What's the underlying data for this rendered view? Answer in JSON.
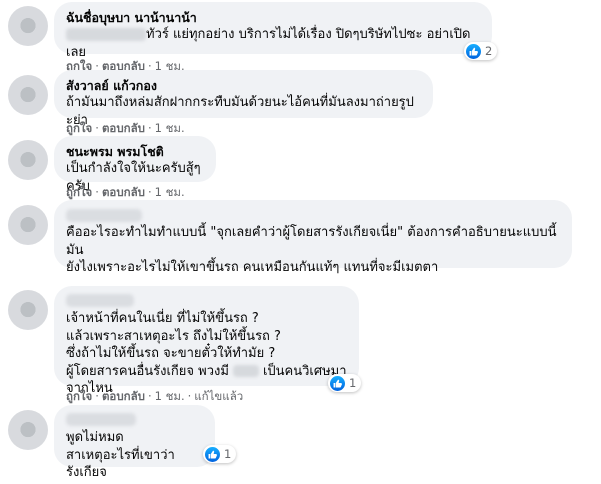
{
  "actions": {
    "like": "ถูกใจ",
    "reply": "ตอบกลับ",
    "time_1h": "1 ชม.",
    "edited": "แก้ไขแล้ว"
  },
  "comments": [
    {
      "author": "ฉันชื่อบุษบา นาน้านาน้า",
      "text": "ทัวร์ แย่ทุกอย่าง บริการไม่ได้เรื่อง ปิดๆบริษัทไปซะ อย่าเปิดเลย",
      "reaction_count": "2"
    },
    {
      "author": "สังวาลย์ แก้วกอง",
      "text": "ถ้ามันมาถึงหล่มสักฝากกระทืบมันด้วยนะไอ้คนที่มันลงมาถ่ายรูป ะย่า"
    },
    {
      "author": "ชนะพรม พรมโชติ",
      "text": "เป็นกำลังใจให้นะครับสู้ๆครับ"
    },
    {
      "author": "",
      "text_lines": [
        "คืออะไรอะทำไมทำแบบนี้ \"จุกเลยคำว่าผู้โดยสารรังเกียจเนี่ย\" ต้องการคำอธิบายนะแบบนี้ มัน",
        "ยังไงเพราะอะไรไม่ให้เขาขึ้นรถ คนเหมือนกันแท้ๆ แทนที่จะมีเมตตา"
      ]
    },
    {
      "author": "",
      "text_lines": [
        "เจ้าหน้าที่คนในเนี่ย ที่ไม่ให้ขึ้นรถ ?",
        "แล้วเพราะสาเหตุอะไร ถึงไม่ให้ขึ้นรถ ?",
        "ซึ่งถ้าไม่ให้ขึ้นรถ จะขายตั๋วให้ทำมัย ?",
        "ผู้โดยสารคนอื่นรังเกียจ พวงมี",
        "เป็นคนวิเศษมาจากไหน"
      ],
      "reaction_count": "1"
    },
    {
      "author": "",
      "text_lines": [
        "พูดไม่หมด",
        "สาเหตุอะไรที่เขาว่ารังเกียจ"
      ],
      "reaction_count": "1"
    }
  ]
}
